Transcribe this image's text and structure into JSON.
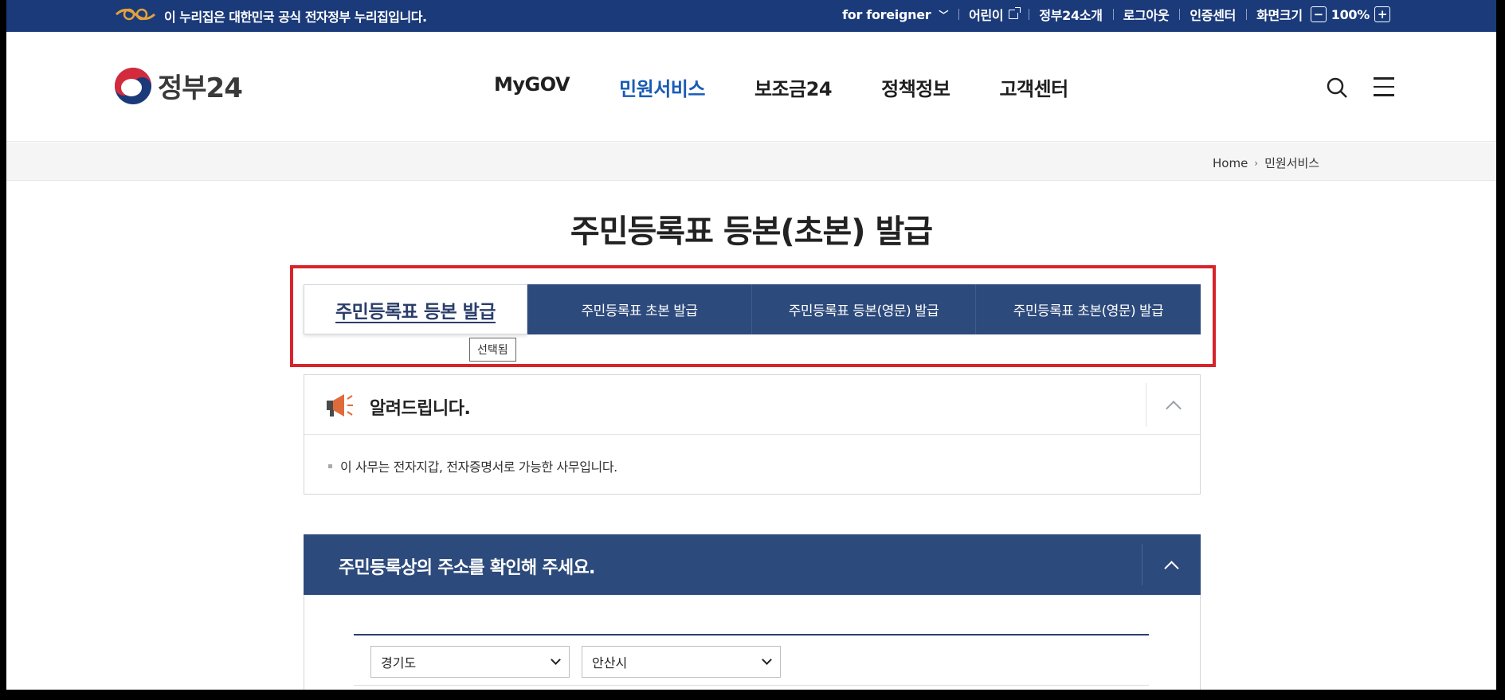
{
  "gov_bar": {
    "notice": "이 누리집은 대한민국 공식 전자정부 누리집입니다.",
    "util": {
      "foreigner": "for foreigner",
      "kids": "어린이",
      "about": "정부24소개",
      "logout": "로그아웃",
      "cert": "인증센터",
      "zoom_label": "화면크기",
      "zoom_minus": "−",
      "zoom_value": "100%",
      "zoom_plus": "+"
    }
  },
  "header": {
    "logo_text": "정부24",
    "nav": [
      "MyGOV",
      "민원서비스",
      "보조금24",
      "정책정보",
      "고객센터"
    ],
    "active_nav": "민원서비스"
  },
  "breadcrumb": {
    "home": "Home",
    "current": "민원서비스"
  },
  "page_title": "주민등록표 등본(초본) 발급",
  "tabs": {
    "items": [
      "주민등록표 등본 발급",
      "주민등록표 초본 발급",
      "주민등록표 등본(영문) 발급",
      "주민등록표 초본(영문) 발급"
    ],
    "selected_tooltip": "선택됨"
  },
  "notice_box": {
    "title": "알려드립니다.",
    "text": "이 사무는 전자지갑, 전자증명서로 가능한 사무입니다."
  },
  "address": {
    "title": "주민등록상의 주소를 확인해 주세요.",
    "province": "경기도",
    "city": "안산시"
  },
  "colors": {
    "nav_dark": "#1a3a7a",
    "tab_blue": "#2d4a7c",
    "highlight_red": "#d8232a",
    "active_link": "#1a5bb5"
  }
}
